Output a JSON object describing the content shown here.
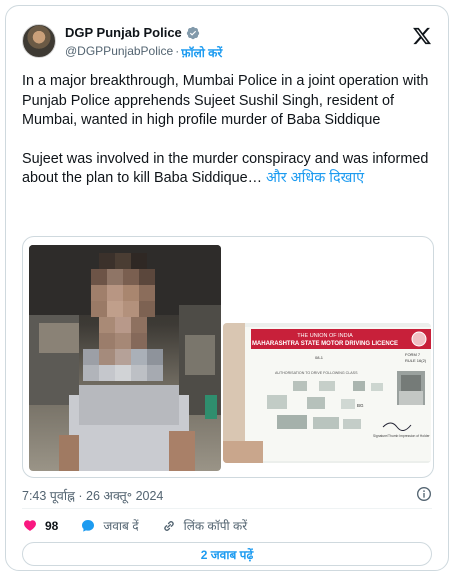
{
  "author": {
    "name": "DGP Punjab Police",
    "handle": "@DGPPunjabPolice",
    "separator": "·",
    "follow_label": "फ़ॉलो करें"
  },
  "tweet": {
    "paragraph1": "In a major breakthrough, Mumbai Police in a joint operation with Punjab Police apprehends Sujeet Sushil Singh, resident of Mumbai, wanted in high profile murder of Baba Siddique",
    "paragraph2": "Sujeet was involved in the murder conspiracy and was informed about the plan to kill Baba Siddique…",
    "show_more": "और अधिक दिखाएं"
  },
  "license_card": {
    "line1": "THE UNION OF INDIA",
    "line2": "MAHARASHTRA STATE MOTOR DRIVING LICENCE",
    "form": "FORM 7",
    "rule": "RULE 16(2)",
    "authorisation": "AUTHORISATION TO DRIVE FOLLOWING CLASS",
    "code1": "08-1",
    "code2": "BG",
    "signature_label": "Signature/Thumb Impression of Holder"
  },
  "meta": {
    "time": "7:43 पूर्वाह्न",
    "separator": "·",
    "date": "26 अक्तू॰ 2024"
  },
  "actions": {
    "like_count": "98",
    "reply_label": "जवाब दें",
    "copy_link_label": "लिंक कॉपी करें"
  },
  "replies_button": "2 जवाब पढ़ें",
  "colors": {
    "accent": "#1d9bf0",
    "like": "#f91880",
    "text": "#0f1419",
    "muted": "#536471",
    "border": "#cfd9de"
  },
  "icons": [
    "verified-badge-icon",
    "x-logo-icon",
    "info-icon",
    "heart-icon",
    "reply-bubble-icon",
    "link-icon"
  ]
}
